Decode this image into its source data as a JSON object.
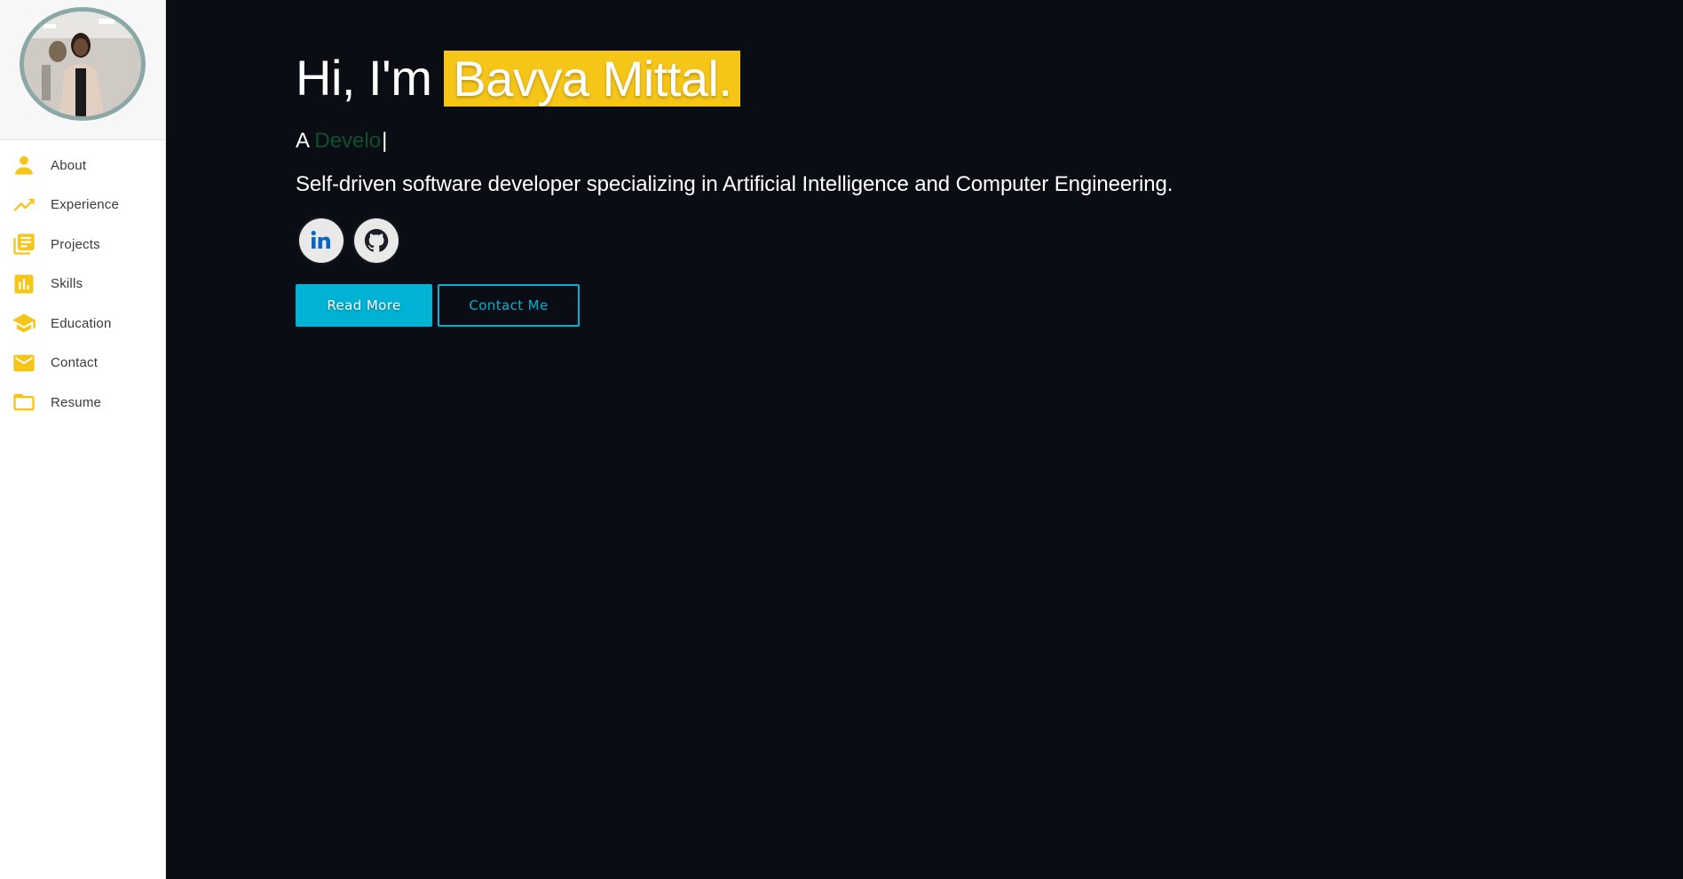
{
  "sidebar": {
    "avatar_alt": "Profile photo",
    "items": [
      {
        "label": "About",
        "icon": "person-icon"
      },
      {
        "label": "Experience",
        "icon": "trending-up-icon"
      },
      {
        "label": "Projects",
        "icon": "library-books-icon"
      },
      {
        "label": "Skills",
        "icon": "bar-chart-icon"
      },
      {
        "label": "Education",
        "icon": "school-icon"
      },
      {
        "label": "Contact",
        "icon": "mail-icon"
      },
      {
        "label": "Resume",
        "icon": "folder-icon"
      }
    ]
  },
  "hero": {
    "greeting": "Hi, I'm",
    "name": "Bavya Mittal.",
    "tagline_prefix": "A",
    "tagline_typed": "Develo",
    "cursor": "|",
    "description": "Self-driven software developer specializing in Artificial Intelligence and Computer Engineering."
  },
  "socials": [
    {
      "name": "linkedin",
      "icon": "linkedin-icon"
    },
    {
      "name": "github",
      "icon": "github-icon"
    }
  ],
  "buttons": {
    "primary": "Read More",
    "secondary": "Contact Me"
  },
  "colors": {
    "accent_yellow": "#f5c518",
    "accent_cyan": "#00b2d3",
    "background": "#0b0d14",
    "typed_text": "#0e4f2c"
  }
}
